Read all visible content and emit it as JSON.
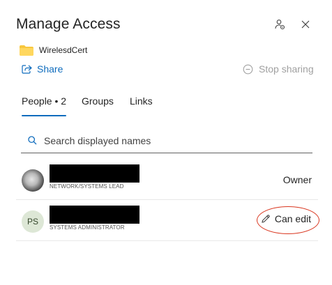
{
  "dialog": {
    "title": "Manage Access"
  },
  "item": {
    "name": "WirelesdCert",
    "icon": "folder-icon",
    "folder_color": "#f8c73e"
  },
  "actions": {
    "share_label": "Share",
    "stop_sharing_label": "Stop sharing"
  },
  "tabs": [
    {
      "label": "People • 2",
      "active": true
    },
    {
      "label": "Groups",
      "active": false
    },
    {
      "label": "Links",
      "active": false
    }
  ],
  "search": {
    "placeholder": "Search displayed names",
    "value": ""
  },
  "people": [
    {
      "avatar": "photo",
      "role": "NETWORK/SYSTEMS LEAD",
      "permission": "Owner"
    },
    {
      "avatar": "initials",
      "initials": "PS",
      "role": "SYSTEMS ADMINISTRATOR",
      "permission": "Can edit"
    }
  ],
  "colors": {
    "accent": "#0f6cbd",
    "disabled": "#a0a0a0",
    "annotation": "#d9361f"
  }
}
